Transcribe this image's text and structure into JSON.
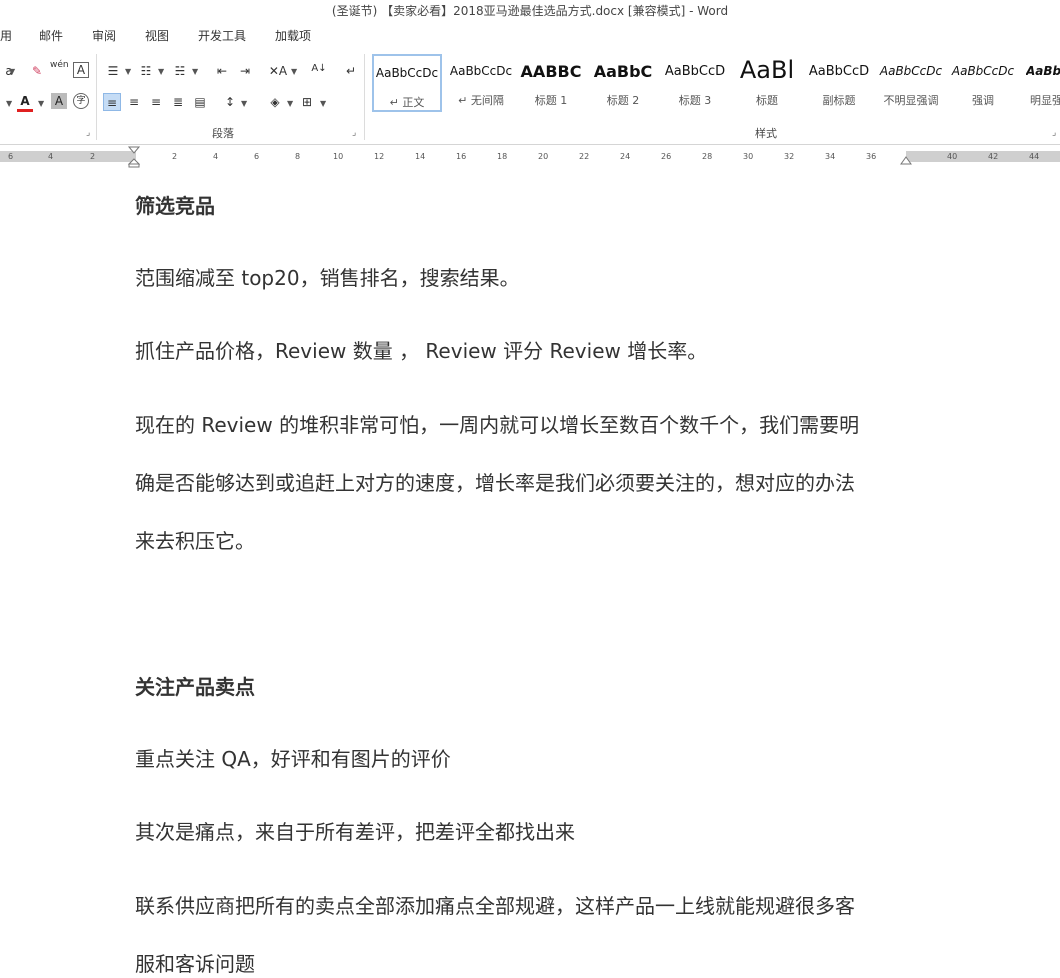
{
  "window": {
    "title": "(圣诞节) 【卖家必看】2018亚马逊最佳选品方式.docx [兼容模式] - Word"
  },
  "tabs": [
    "用",
    "邮件",
    "审阅",
    "视图",
    "开发工具",
    "加载项"
  ],
  "ribbon": {
    "group_paragraph": "段落",
    "group_styles": "样式",
    "styles": [
      {
        "preview": "AaBbCcDc",
        "name": "↵ 正文"
      },
      {
        "preview": "AaBbCcDc",
        "name": "↵ 无间隔"
      },
      {
        "preview": "AABBC",
        "name": "标题 1"
      },
      {
        "preview": "AaBbC",
        "name": "标题 2"
      },
      {
        "preview": "AaBbCcD",
        "name": "标题 3"
      },
      {
        "preview": "AaBl",
        "name": "标题"
      },
      {
        "preview": "AaBbCcD",
        "name": "副标题"
      },
      {
        "preview": "AaBbCcDc",
        "name": "不明显强调"
      },
      {
        "preview": "AaBbCcDc",
        "name": "强调"
      },
      {
        "preview": "AaBbC",
        "name": "明显强"
      }
    ],
    "icons": {
      "font_a": "A",
      "wen": "wén",
      "char_border": "A",
      "font_color": "A",
      "shade_a": "A",
      "enclose": "字",
      "sort": "A↓",
      "para_mark": "↵"
    }
  },
  "ruler": {
    "left_numbers": [
      "6",
      "4",
      "2"
    ],
    "right_numbers": [
      "2",
      "4",
      "6",
      "8",
      "10",
      "12",
      "14",
      "16",
      "18",
      "20",
      "22",
      "24",
      "26",
      "28",
      "30",
      "32",
      "34",
      "36"
    ],
    "margin_numbers": [
      "40",
      "42",
      "44"
    ]
  },
  "document": {
    "paragraphs": [
      {
        "text": "筛选竞品",
        "heading": true
      },
      {
        "text": "范围缩减至 top20，销售排名，搜索结果。"
      },
      {
        "text": "抓住产品价格，Review 数量 ，  Review 评分   Review 增长率。"
      },
      {
        "text": "现在的 Review 的堆积非常可怕，一周内就可以增长至数百个数千个，我们需要明"
      },
      {
        "text": "确是否能够达到或追赶上对方的速度，增长率是我们必须要关注的，想对应的办法"
      },
      {
        "text": "来去积压它。"
      },
      {
        "text": "关注产品卖点",
        "heading": true
      },
      {
        "text": "重点关注 QA，好评和有图片的评价"
      },
      {
        "text": "其次是痛点，来自于所有差评，把差评全都找出来"
      },
      {
        "text": "联系供应商把所有的卖点全部添加痛点全部规避，这样产品一上线就能规避很多客"
      },
      {
        "text": "服和客诉问题"
      }
    ]
  },
  "colors": {
    "accent_selected": "#c5dcf5",
    "font_color_bar": "#e02020",
    "ruler_gray": "#cfcfcf"
  }
}
